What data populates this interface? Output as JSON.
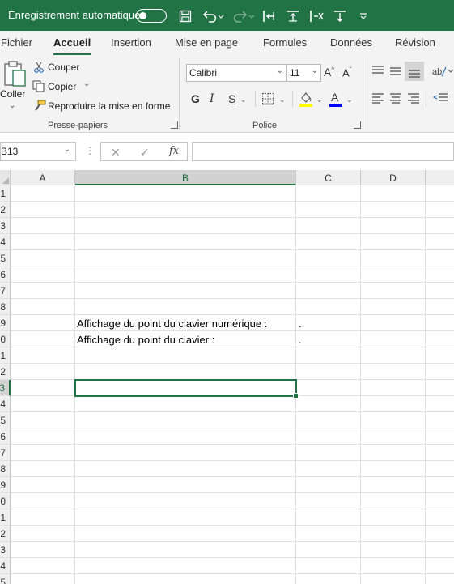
{
  "title_bar": {
    "autosave_label": "Enregistrement automatique",
    "autosave_state": "off",
    "background": "#217346",
    "quick_access_icons": [
      "save-icon",
      "undo-icon",
      "redo-icon",
      "border-left-icon",
      "border-insert-icon",
      "border-delete-icon",
      "border-top-icon",
      "customize-quick-access-icon"
    ]
  },
  "tabs": [
    {
      "label": "Fichier",
      "active": false
    },
    {
      "label": "Accueil",
      "active": true
    },
    {
      "label": "Insertion",
      "active": false
    },
    {
      "label": "Mise en page",
      "active": false
    },
    {
      "label": "Formules",
      "active": false
    },
    {
      "label": "Données",
      "active": false
    },
    {
      "label": "Révision",
      "active": false
    }
  ],
  "ribbon": {
    "clipboard": {
      "paste_label": "Coller",
      "cut_label": "Couper",
      "copy_label": "Copier",
      "format_painter_label": "Reproduire la mise en forme",
      "group_label": "Presse-papiers"
    },
    "font": {
      "font_name": "Calibri",
      "font_size": "11",
      "bold_label": "G",
      "italic_label": "I",
      "underline_label": "S",
      "font_color": "#0000ff",
      "fill_color": "#ffff00",
      "group_label": "Police"
    }
  },
  "formula_bar": {
    "name_box": "B13",
    "formula": ""
  },
  "grid": {
    "columns": [
      "A",
      "B",
      "C",
      "D"
    ],
    "selected_column": "B",
    "rows": [
      "1",
      "2",
      "3",
      "4",
      "5",
      "6",
      "7",
      "8",
      "9",
      "0",
      "1",
      "2",
      "3",
      "4",
      "5",
      "6",
      "7",
      "8",
      "9",
      "0",
      "1",
      "2",
      "3",
      "4",
      "5"
    ],
    "selected_row_index": 12,
    "cells": {
      "B9": "Affichage du point du clavier numérique :",
      "C9": ".",
      "B10": "Affichage du point du clavier :",
      "C10": "."
    },
    "active_cell": "B13",
    "accent_color": "#217346"
  }
}
